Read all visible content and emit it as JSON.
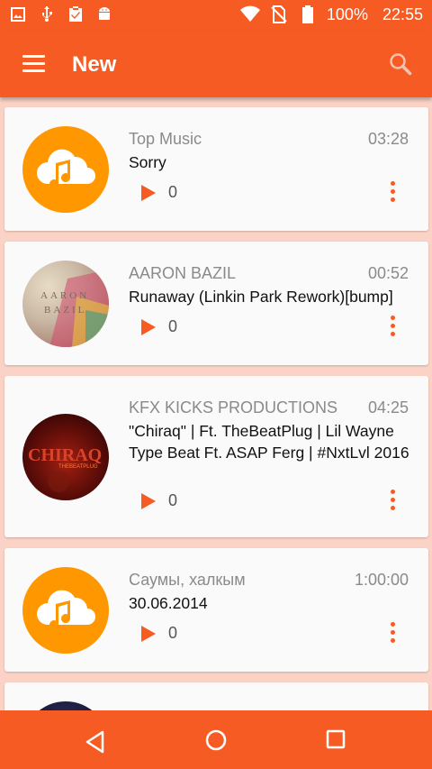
{
  "status_bar": {
    "battery_percent": "100%",
    "time": "22:55",
    "icons": [
      "image-icon",
      "usb-icon",
      "clipboard-check-icon",
      "android-icon",
      "wifi-icon",
      "no-sim-icon",
      "battery-icon"
    ]
  },
  "app_bar": {
    "title": "New",
    "menu_icon": "menu-icon",
    "search_icon": "search-icon"
  },
  "tracks": [
    {
      "author": "Top Music",
      "duration": "03:28",
      "title": "Sorry",
      "plays": "0",
      "artwork": "cloud-music-icon"
    },
    {
      "author": "AARON BAZIL",
      "duration": "00:52",
      "title": "Runaway (Linkin Park Rework)[bump]",
      "plays": "0",
      "artwork": "album-art"
    },
    {
      "author": "KFX KICKS PRODUCTIONS",
      "duration": "04:25",
      "title": "\"Chiraq\" | Ft. TheBeatPlug | Lil Wayne Type Beat Ft. ASAP Ferg | #NxtLvl 2016",
      "plays": "0",
      "artwork": "album-art"
    },
    {
      "author": "Саумы, халкым",
      "duration": "1:00:00",
      "title": "30.06.2014",
      "plays": "0",
      "artwork": "cloud-music-icon"
    },
    {
      "author": "",
      "duration": "",
      "title": "",
      "plays": "",
      "artwork": "album-art"
    }
  ],
  "colors": {
    "accent": "#f65b24",
    "artwork_orange": "#ff9800",
    "background": "#fbd3c6"
  }
}
